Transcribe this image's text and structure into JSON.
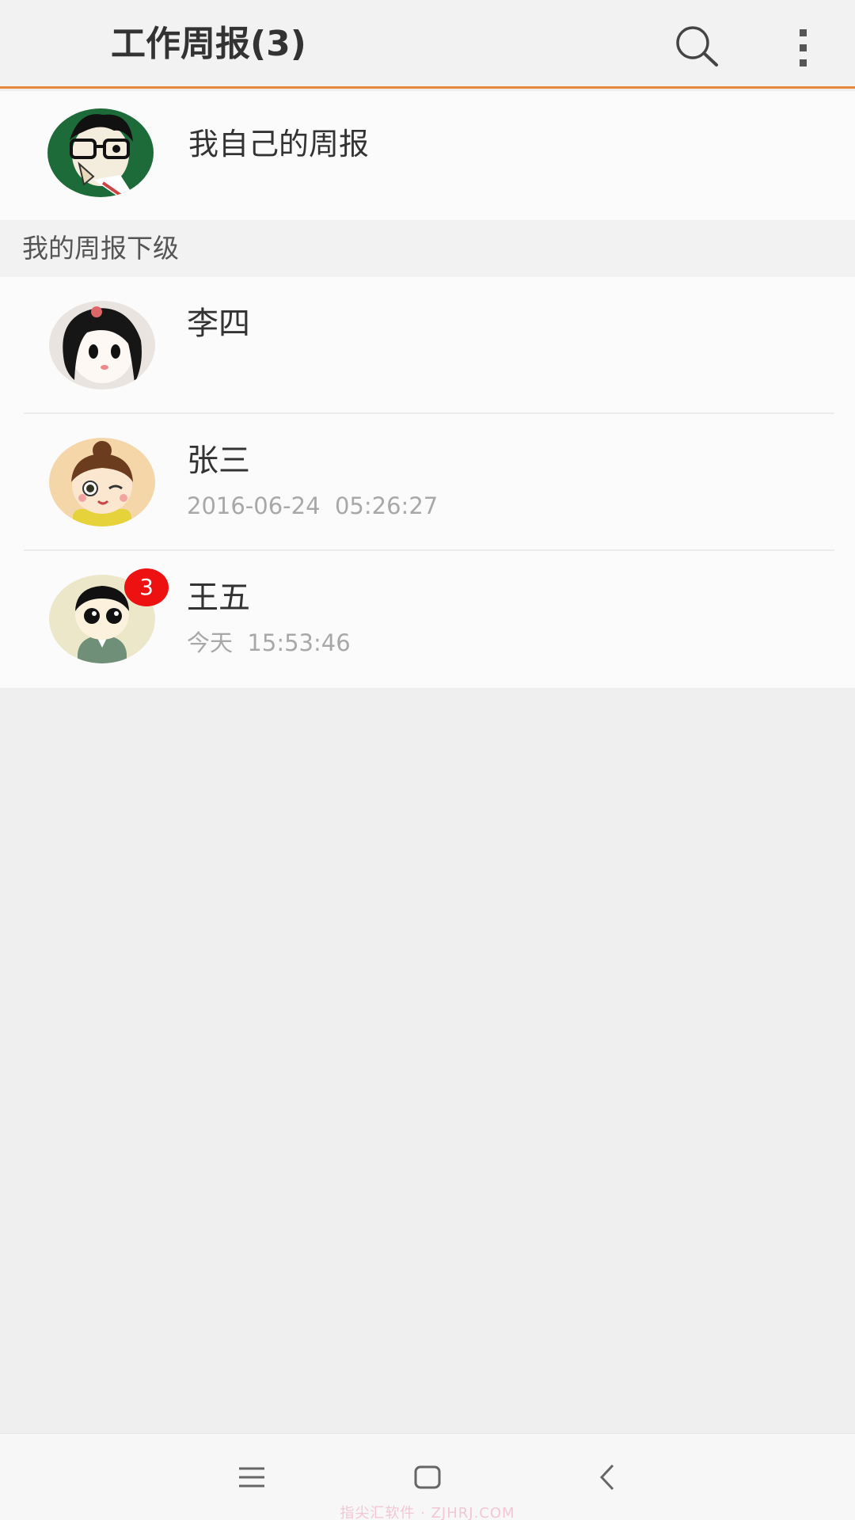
{
  "header": {
    "title": "工作周报(3)",
    "search_icon": "search-icon",
    "more_icon": "more-vertical-icon",
    "accent_color": "#e8893a"
  },
  "self": {
    "label": "我自己的周报"
  },
  "section": {
    "title": "我的周报下级"
  },
  "subordinates": [
    {
      "name": "李四",
      "time": ""
    },
    {
      "name": "张三",
      "time": "2016-06-24  05:26:27"
    },
    {
      "name": "王五",
      "time": "今天  15:53:46",
      "badge": "3"
    }
  ],
  "navbar": {
    "menu_icon": "menu-icon",
    "home_icon": "home-icon",
    "back_icon": "back-icon",
    "watermark": "指尖汇软件 · ZJHRJ.COM"
  },
  "colors": {
    "badge": "#ee1111",
    "background": "#efefef"
  }
}
